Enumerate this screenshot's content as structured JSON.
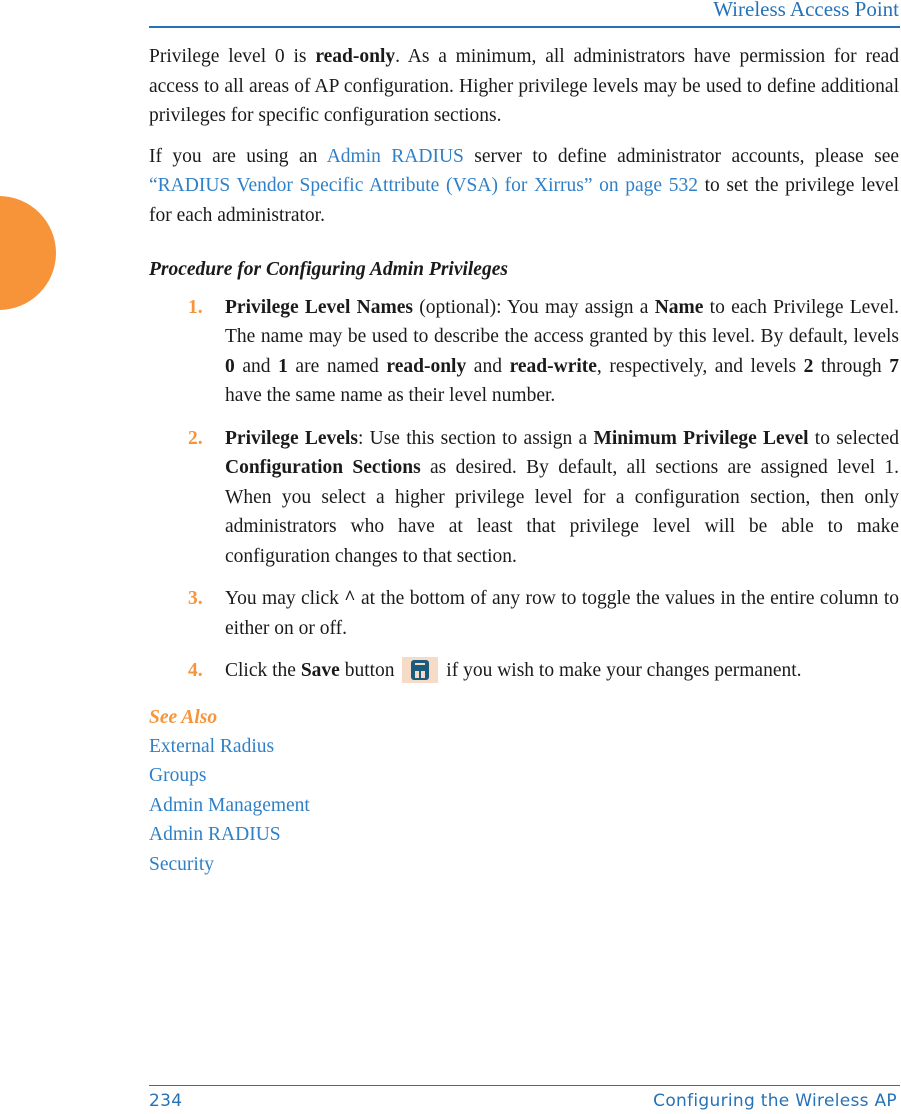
{
  "header": {
    "title": "Wireless Access Point"
  },
  "colors": {
    "accent_blue": "#2672b8",
    "link_blue": "#2f80c6",
    "accent_orange": "#f7943a"
  },
  "intro": {
    "p1": {
      "t1": "Privilege level 0 is ",
      "b1": "read-only",
      "t2": ". As a minimum, all administrators have permission for read access to all areas of AP configuration. Higher privilege levels may be used to define additional privileges for specific configuration sections."
    },
    "p2": {
      "t1": "If you are using an ",
      "link1": "Admin RADIUS",
      "t2": " server to define administrator accounts, please see ",
      "link2": "“RADIUS Vendor Specific Attribute (VSA) for Xirrus” on page 532",
      "t3": " to set the privilege level for each administrator."
    }
  },
  "procedure": {
    "heading": "Procedure for Configuring Admin Privileges",
    "steps": [
      {
        "num": "1.",
        "b1": "Privilege Level Names",
        "t1": " (optional): You may assign a ",
        "b2": "Name",
        "t2": " to each Privilege Level. The name may be used to describe the access granted by this level. By default, levels ",
        "b3": "0",
        "t3": " and ",
        "b4": "1",
        "t4": " are named ",
        "b5": "read-only",
        "t5": " and ",
        "b6": "read-write",
        "t6": ", respectively, and levels ",
        "b7": "2",
        "t7": " through ",
        "b8": "7",
        "t8": " have the same name as their level number."
      },
      {
        "num": "2.",
        "b1": "Privilege Levels",
        "t1": ": Use this section to assign a ",
        "b2": "Minimum Privilege Level",
        "t2": " to selected ",
        "b3": "Configuration Sections",
        "t3": " as desired. By default, all sections are assigned level 1. When you select a higher privilege level for a configuration section, then only administrators who have at least that privilege level will be able to make configuration changes to that section."
      },
      {
        "num": "3.",
        "t1": "You may click ",
        "b1": "^",
        "t2": " at the bottom of any row to toggle the values in the entire column to either on or off."
      },
      {
        "num": "4.",
        "t1": "Click the ",
        "b1": "Save",
        "t2": " button ",
        "icon": "save-icon",
        "t3": " if you wish to make your changes permanent."
      }
    ]
  },
  "see_also": {
    "heading": "See Also",
    "links": [
      "External Radius",
      "Groups",
      "Admin Management",
      "Admin RADIUS",
      "Security"
    ]
  },
  "footer": {
    "page_number": "234",
    "chapter": "Configuring the Wireless AP"
  }
}
